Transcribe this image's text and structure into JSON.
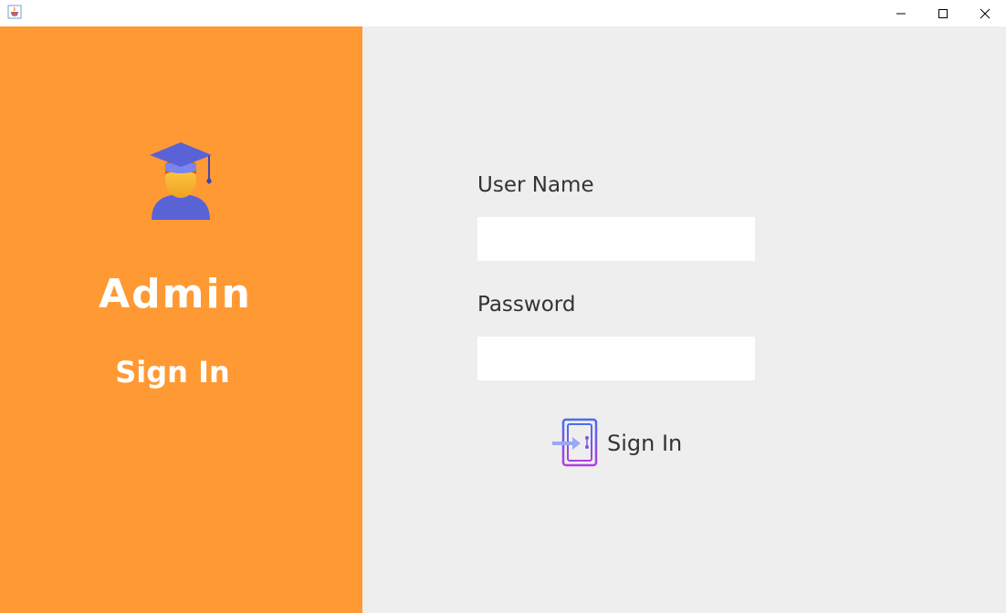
{
  "window": {
    "minimize_icon": "minimize-icon",
    "maximize_icon": "maximize-icon",
    "close_icon": "close-icon",
    "app_icon": "java-icon"
  },
  "left_panel": {
    "background": "#ff9933",
    "icon": "graduate-icon",
    "title": "Admin",
    "subtitle": "Sign In"
  },
  "form": {
    "username_label": "User Name",
    "username_value": "",
    "password_label": "Password",
    "password_value": "",
    "signin_label": "Sign In",
    "signin_icon": "door-enter-icon"
  },
  "colors": {
    "accent": "#ff9933",
    "panel_bg": "#eeeeee",
    "text": "#333333"
  }
}
